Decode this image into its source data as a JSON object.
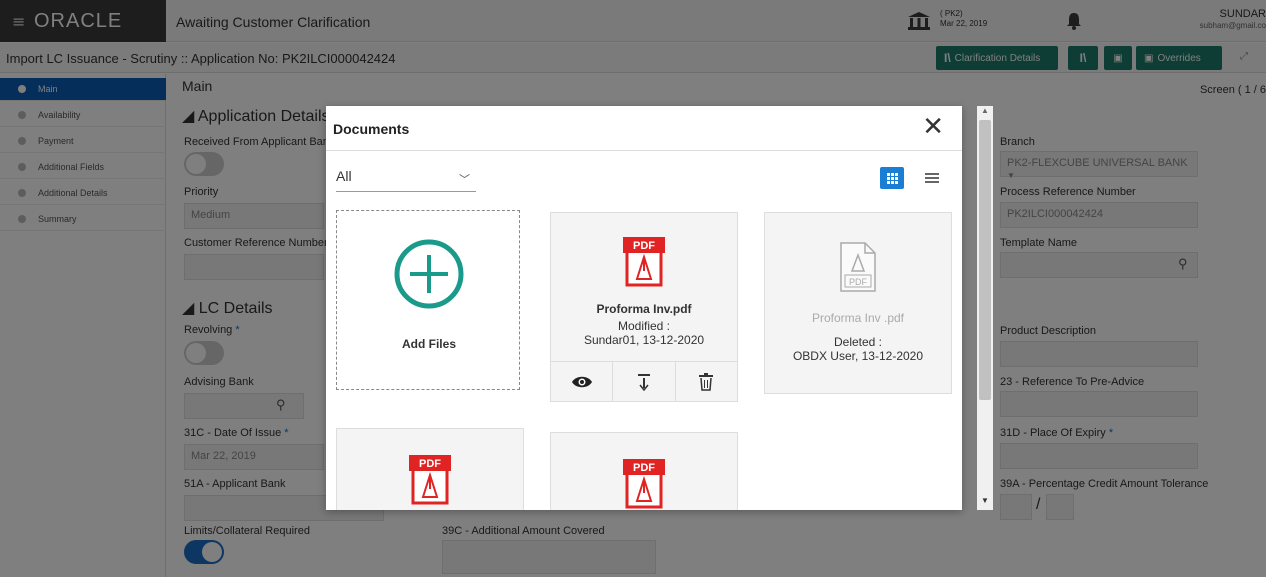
{
  "header": {
    "logo": "ORACLE",
    "status_title": "Awaiting Customer Clarification",
    "branch_code": "( PK2)",
    "branch_date": "Mar 22, 2019",
    "user_name": "SUNDAR",
    "user_email": "subham@gmail.co"
  },
  "subheader": {
    "title": "Import LC Issuance - Scrutiny :: Application No: PK2ILCI000042424",
    "clarification_label": "Clarification Details",
    "overrides_label": "Overrides"
  },
  "sidebar": {
    "items": [
      {
        "label": "Main"
      },
      {
        "label": "Availability"
      },
      {
        "label": "Payment"
      },
      {
        "label": "Additional Fields"
      },
      {
        "label": "Additional Details"
      },
      {
        "label": "Summary"
      }
    ]
  },
  "main": {
    "title": "Main",
    "screen_label": "Screen ( 1 / 6",
    "app_details_heading": "Application Details",
    "received_from_label": "Received From Applicant Ban",
    "priority_label": "Priority",
    "priority_value": "Medium",
    "customer_ref_label": "Customer Reference Number",
    "lc_details_heading": "LC Details",
    "revolving_label": "Revolving",
    "advising_bank_label": "Advising Bank",
    "date_of_issue_label": "31C - Date Of Issue",
    "date_of_issue_value": "Mar 22, 2019",
    "applicant_bank_label": "51A - Applicant Bank",
    "limits_label": "Limits/Collateral Required",
    "additional_amount_label": "39C - Additional Amount Covered",
    "branch_label": "Branch",
    "branch_value": "PK2-FLEXCUBE UNIVERSAL BANK",
    "process_ref_label": "Process Reference Number",
    "process_ref_value": "PK2ILCI000042424",
    "template_label": "Template Name",
    "product_desc_label": "Product Description",
    "pre_advice_label": "23 - Reference To Pre-Advice",
    "place_of_expiry_label": "31D - Place Of Expiry",
    "tolerance_label": "39A - Percentage Credit Amount Tolerance",
    "tolerance_sep": "/"
  },
  "modal": {
    "title": "Documents",
    "filter_value": "All",
    "add_files_label": "Add Files",
    "docs": [
      {
        "name": "Proforma Inv.pdf",
        "status": "Modified :",
        "by": "Sundar01, 13-12-2020"
      },
      {
        "name": "Proforma Inv .pdf",
        "status": "Deleted :",
        "by": "OBDX User, 13-12-2020"
      }
    ]
  },
  "icons": {
    "pdf_badge": "PDF"
  },
  "colors": {
    "accent": "#1b7a6a",
    "sidebar_active": "#0a5fb4",
    "add_icon": "#1a9a8a",
    "pdf_red": "#e02424"
  }
}
